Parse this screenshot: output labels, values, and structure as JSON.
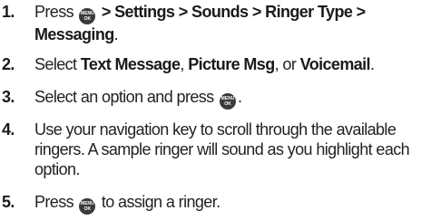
{
  "steps": [
    {
      "number": "1.",
      "press": "Press",
      "key_top": "MENU",
      "key_bottom": "OK",
      "path": "> Settings > Sounds > Ringer Type > Messaging",
      "end": "."
    },
    {
      "number": "2.",
      "select": "Select",
      "option1": "Text Message",
      "sep1": ",",
      "option2": "Picture Msg",
      "sep2": ", or",
      "option3": "Voicemail",
      "end": "."
    },
    {
      "number": "3.",
      "text": "Select an option and press",
      "key_top": "MENU",
      "key_bottom": "OK",
      "end": "."
    },
    {
      "number": "4.",
      "text": "Use your navigation key to scroll through the available ringers. A sample ringer will sound as you highlight each option."
    },
    {
      "number": "5.",
      "press": "Press",
      "key_top": "MENU",
      "key_bottom": "OK",
      "text": "to assign a ringer."
    }
  ]
}
